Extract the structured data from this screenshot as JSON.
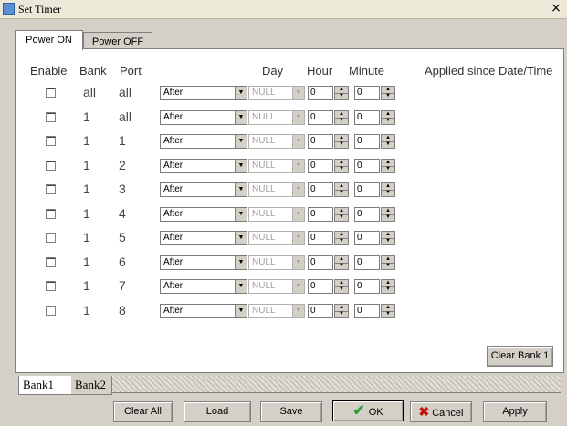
{
  "window": {
    "title": "Set Timer",
    "close": "×"
  },
  "tabs": [
    "Power ON",
    "Power OFF"
  ],
  "headers": {
    "enable": "Enable",
    "bank": "Bank",
    "port": "Port",
    "day": "Day",
    "hour": "Hour",
    "minute": "Minute",
    "applied": "Applied since Date/Time"
  },
  "rows": [
    {
      "bank": "all",
      "port": "all",
      "mode": "After",
      "day": "NULL",
      "hour": "0",
      "minute": "0"
    },
    {
      "bank": "1",
      "port": "all",
      "mode": "After",
      "day": "NULL",
      "hour": "0",
      "minute": "0"
    },
    {
      "bank": "1",
      "port": "1",
      "mode": "After",
      "day": "NULL",
      "hour": "0",
      "minute": "0"
    },
    {
      "bank": "1",
      "port": "2",
      "mode": "After",
      "day": "NULL",
      "hour": "0",
      "minute": "0"
    },
    {
      "bank": "1",
      "port": "3",
      "mode": "After",
      "day": "NULL",
      "hour": "0",
      "minute": "0"
    },
    {
      "bank": "1",
      "port": "4",
      "mode": "After",
      "day": "NULL",
      "hour": "0",
      "minute": "0"
    },
    {
      "bank": "1",
      "port": "5",
      "mode": "After",
      "day": "NULL",
      "hour": "0",
      "minute": "0"
    },
    {
      "bank": "1",
      "port": "6",
      "mode": "After",
      "day": "NULL",
      "hour": "0",
      "minute": "0"
    },
    {
      "bank": "1",
      "port": "7",
      "mode": "After",
      "day": "NULL",
      "hour": "0",
      "minute": "0"
    },
    {
      "bank": "1",
      "port": "8",
      "mode": "After",
      "day": "NULL",
      "hour": "0",
      "minute": "0"
    }
  ],
  "clear_bank_label": "Clear Bank 1",
  "bank_tabs": [
    "Bank1",
    "Bank2"
  ],
  "buttons": {
    "clear_all": "Clear All",
    "load": "Load",
    "save": "Save",
    "ok": "OK",
    "cancel": "Cancel",
    "apply": "Apply"
  },
  "icons": {
    "ok": "check-icon",
    "cancel": "x-icon",
    "dropdown": "triangle-down",
    "spin": "triangle-up-down"
  },
  "colors": {
    "ok_check": "#2e9e2e",
    "cancel_x": "#cc1010"
  }
}
